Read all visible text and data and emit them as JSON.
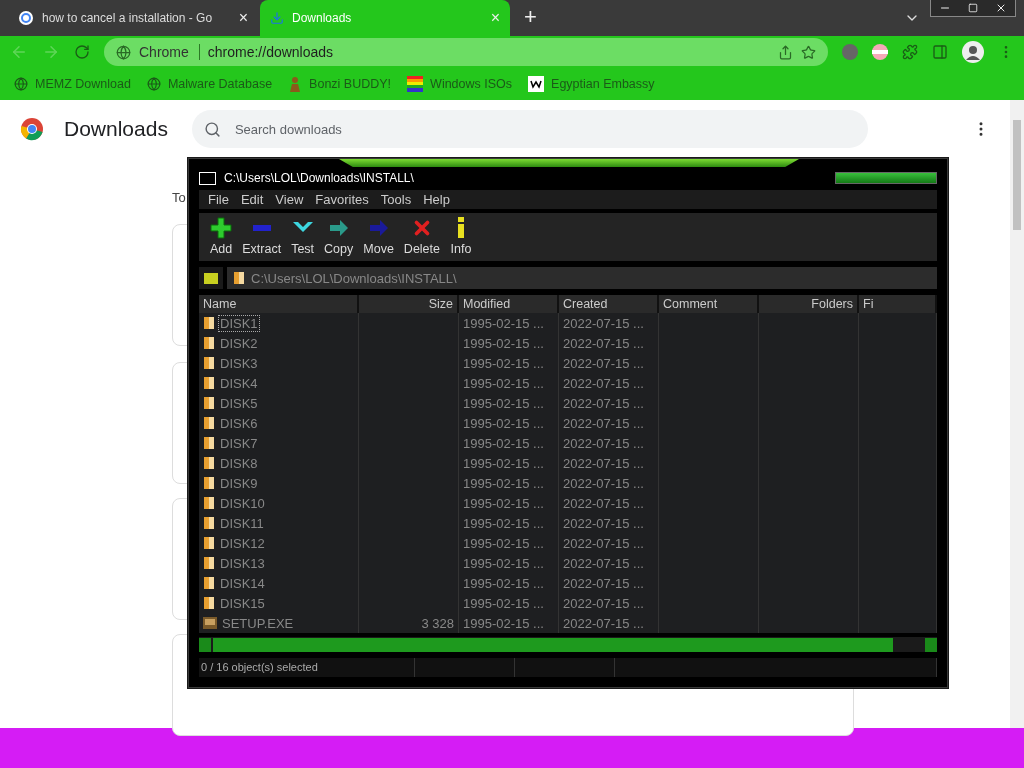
{
  "tabs": [
    {
      "title": "how to cancel a installation - Go",
      "selected": false,
      "close": "×"
    },
    {
      "title": "Downloads",
      "selected": true,
      "close": "×"
    }
  ],
  "new_tab": "+",
  "address_bar": {
    "site": "Chrome",
    "url": "chrome://downloads"
  },
  "bookmarks": [
    {
      "label": "MEMZ Download",
      "kind": "globe"
    },
    {
      "label": "Malware Database",
      "kind": "globe"
    },
    {
      "label": "Bonzi BUDDY!",
      "kind": "figure"
    },
    {
      "label": "Windows ISOs",
      "kind": "flag"
    },
    {
      "label": "Egyptian Embassy",
      "kind": "wix"
    }
  ],
  "downloads_page": {
    "title": "Downloads",
    "search_placeholder": "Search downloads",
    "partial_text": "To"
  },
  "archiver": {
    "title": "C:\\Users\\LOL\\Downloads\\INSTALL\\",
    "menu": [
      "File",
      "Edit",
      "View",
      "Favorites",
      "Tools",
      "Help"
    ],
    "toolbar": [
      {
        "label": "Add",
        "kind": "add"
      },
      {
        "label": "Extract",
        "kind": "extract"
      },
      {
        "label": "Test",
        "kind": "test"
      },
      {
        "label": "Copy",
        "kind": "copy"
      },
      {
        "label": "Move",
        "kind": "move"
      },
      {
        "label": "Delete",
        "kind": "delete"
      },
      {
        "label": "Info",
        "kind": "info"
      }
    ],
    "path": "C:\\Users\\LOL\\Downloads\\INSTALL\\",
    "columns": [
      "Name",
      "Size",
      "Modified",
      "Created",
      "Comment",
      "Folders",
      "Fi"
    ],
    "rows": [
      {
        "name": "DISK1",
        "size": "",
        "modified": "1995-02-15 ...",
        "created": "2022-07-15 ...",
        "kind": "folder",
        "focused": true
      },
      {
        "name": "DISK2",
        "size": "",
        "modified": "1995-02-15 ...",
        "created": "2022-07-15 ...",
        "kind": "folder",
        "focused": false
      },
      {
        "name": "DISK3",
        "size": "",
        "modified": "1995-02-15 ...",
        "created": "2022-07-15 ...",
        "kind": "folder",
        "focused": false
      },
      {
        "name": "DISK4",
        "size": "",
        "modified": "1995-02-15 ...",
        "created": "2022-07-15 ...",
        "kind": "folder",
        "focused": false
      },
      {
        "name": "DISK5",
        "size": "",
        "modified": "1995-02-15 ...",
        "created": "2022-07-15 ...",
        "kind": "folder",
        "focused": false
      },
      {
        "name": "DISK6",
        "size": "",
        "modified": "1995-02-15 ...",
        "created": "2022-07-15 ...",
        "kind": "folder",
        "focused": false
      },
      {
        "name": "DISK7",
        "size": "",
        "modified": "1995-02-15 ...",
        "created": "2022-07-15 ...",
        "kind": "folder",
        "focused": false
      },
      {
        "name": "DISK8",
        "size": "",
        "modified": "1995-02-15 ...",
        "created": "2022-07-15 ...",
        "kind": "folder",
        "focused": false
      },
      {
        "name": "DISK9",
        "size": "",
        "modified": "1995-02-15 ...",
        "created": "2022-07-15 ...",
        "kind": "folder",
        "focused": false
      },
      {
        "name": "DISK10",
        "size": "",
        "modified": "1995-02-15 ...",
        "created": "2022-07-15 ...",
        "kind": "folder",
        "focused": false
      },
      {
        "name": "DISK11",
        "size": "",
        "modified": "1995-02-15 ...",
        "created": "2022-07-15 ...",
        "kind": "folder",
        "focused": false
      },
      {
        "name": "DISK12",
        "size": "",
        "modified": "1995-02-15 ...",
        "created": "2022-07-15 ...",
        "kind": "folder",
        "focused": false
      },
      {
        "name": "DISK13",
        "size": "",
        "modified": "1995-02-15 ...",
        "created": "2022-07-15 ...",
        "kind": "folder",
        "focused": false
      },
      {
        "name": "DISK14",
        "size": "",
        "modified": "1995-02-15 ...",
        "created": "2022-07-15 ...",
        "kind": "folder",
        "focused": false
      },
      {
        "name": "DISK15",
        "size": "",
        "modified": "1995-02-15 ...",
        "created": "2022-07-15 ...",
        "kind": "folder",
        "focused": false
      },
      {
        "name": "SETUP.EXE",
        "size": "3 328",
        "modified": "1995-02-15 ...",
        "created": "2022-07-15 ...",
        "kind": "file",
        "focused": false
      }
    ],
    "status": "0 / 16 object(s) selected"
  }
}
